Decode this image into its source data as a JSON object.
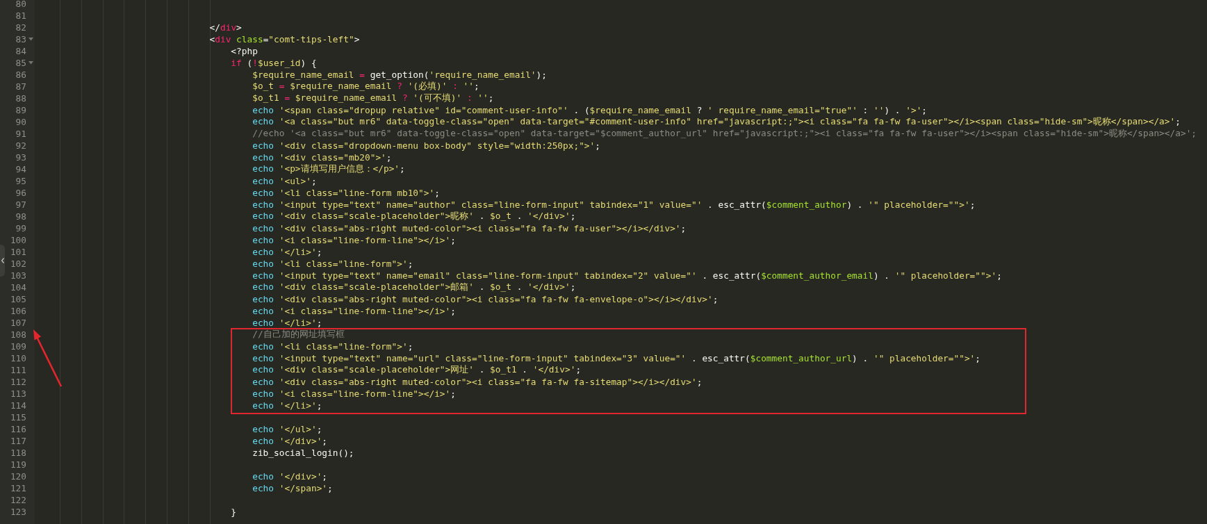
{
  "lines": [
    {
      "number": "80",
      "fold": false,
      "boxed": false
    },
    {
      "number": "81",
      "fold": false,
      "boxed": false
    },
    {
      "number": "82",
      "fold": false,
      "boxed": false,
      "tokens": [
        {
          "kind": "plain",
          "text": "\t\t\t\t\t\t\t\t</"
        },
        {
          "kind": "tag",
          "text": "div"
        },
        {
          "kind": "plain",
          "text": ">"
        }
      ]
    },
    {
      "number": "83",
      "fold": true,
      "boxed": false,
      "tokens": [
        {
          "kind": "plain",
          "text": "\t\t\t\t\t\t\t\t<"
        },
        {
          "kind": "tag",
          "text": "div"
        },
        {
          "kind": "attr",
          "text": " class"
        },
        {
          "kind": "plain",
          "text": "="
        },
        {
          "kind": "str",
          "text": "\"comt-tips-left\""
        },
        {
          "kind": "plain",
          "text": ">"
        }
      ]
    },
    {
      "number": "84",
      "fold": false,
      "boxed": false,
      "tokens": [
        {
          "kind": "plain",
          "text": "\t\t\t\t\t\t\t\t\t<?php"
        }
      ]
    },
    {
      "number": "85",
      "fold": true,
      "boxed": false,
      "tokens": [
        {
          "kind": "kw",
          "text": "\t\t\t\t\t\t\t\t\tif"
        },
        {
          "kind": "plain",
          "text": " ("
        },
        {
          "kind": "op",
          "text": "!"
        },
        {
          "kind": "var",
          "text": "$user_id"
        },
        {
          "kind": "plain",
          "text": ") {"
        }
      ]
    },
    {
      "number": "86",
      "fold": false,
      "boxed": false,
      "tokens": [
        {
          "kind": "var",
          "text": "\t\t\t\t\t\t\t\t\t\t$require_name_email"
        },
        {
          "kind": "op",
          "text": " = "
        },
        {
          "kind": "plain",
          "text": "get_option("
        },
        {
          "kind": "str",
          "text": "'require_name_email'"
        },
        {
          "kind": "plain",
          "text": ");"
        }
      ]
    },
    {
      "number": "87",
      "fold": false,
      "boxed": false,
      "tokens": [
        {
          "kind": "var",
          "text": "\t\t\t\t\t\t\t\t\t\t$o_t"
        },
        {
          "kind": "op",
          "text": " = "
        },
        {
          "kind": "var",
          "text": "$require_name_email"
        },
        {
          "kind": "op",
          "text": " ? "
        },
        {
          "kind": "str",
          "text": "'(必填)'"
        },
        {
          "kind": "op",
          "text": " : "
        },
        {
          "kind": "str",
          "text": "''"
        },
        {
          "kind": "plain",
          "text": ";"
        }
      ]
    },
    {
      "number": "88",
      "fold": false,
      "boxed": false,
      "tokens": [
        {
          "kind": "var",
          "text": "\t\t\t\t\t\t\t\t\t\t$o_t1"
        },
        {
          "kind": "op",
          "text": " = "
        },
        {
          "kind": "var",
          "text": "$require_name_email"
        },
        {
          "kind": "op",
          "text": " ? "
        },
        {
          "kind": "str",
          "text": "'(可不填)'"
        },
        {
          "kind": "op",
          "text": " : "
        },
        {
          "kind": "str",
          "text": "''"
        },
        {
          "kind": "plain",
          "text": ";"
        }
      ]
    },
    {
      "number": "89",
      "fold": false,
      "boxed": false,
      "tokens": [
        {
          "kind": "echo",
          "text": "\t\t\t\t\t\t\t\t\t\techo"
        },
        {
          "kind": "str",
          "text": " '<span class=\"dropup relative\" id=\"comment-user-info\"'"
        },
        {
          "kind": "plain",
          "text": " . ("
        },
        {
          "kind": "var",
          "text": "$require_name_email"
        },
        {
          "kind": "plain",
          "text": " ? "
        },
        {
          "kind": "str",
          "text": "' require_name_email=\"true\"'"
        },
        {
          "kind": "plain",
          "text": " : "
        },
        {
          "kind": "str",
          "text": "''"
        },
        {
          "kind": "plain",
          "text": ") . "
        },
        {
          "kind": "str",
          "text": "'>'"
        },
        {
          "kind": "plain",
          "text": ";"
        }
      ]
    },
    {
      "number": "90",
      "fold": false,
      "boxed": false,
      "tokens": [
        {
          "kind": "echo",
          "text": "\t\t\t\t\t\t\t\t\t\techo"
        },
        {
          "kind": "str",
          "text": " '<a class=\"but mr6\" data-toggle-class=\"open\" data-target=\"#comment-user-info\" href=\"javascript:;\"><i class=\"fa fa-fw fa-user\"></i><span class=\"hide-sm\">昵称</span></a>'"
        },
        {
          "kind": "plain",
          "text": ";"
        }
      ]
    },
    {
      "number": "91",
      "fold": false,
      "boxed": false,
      "tokens": [
        {
          "kind": "comment",
          "text": "\t\t\t\t\t\t\t\t\t\t//echo '<a class=\"but mr6\" data-toggle-class=\"open\" data-target=\"$comment_author_url\" href=\"javascript:;\"><i class=\"fa fa-fw fa-user\"></i><span class=\"hide-sm\">昵称</span></a>';"
        }
      ]
    },
    {
      "number": "92",
      "fold": false,
      "boxed": false,
      "tokens": [
        {
          "kind": "echo",
          "text": "\t\t\t\t\t\t\t\t\t\techo"
        },
        {
          "kind": "str",
          "text": " '<div class=\"dropdown-menu box-body\" style=\"width:250px;\">'"
        },
        {
          "kind": "plain",
          "text": ";"
        }
      ]
    },
    {
      "number": "93",
      "fold": false,
      "boxed": false,
      "tokens": [
        {
          "kind": "echo",
          "text": "\t\t\t\t\t\t\t\t\t\techo"
        },
        {
          "kind": "str",
          "text": " '<div class=\"mb20\">'"
        },
        {
          "kind": "plain",
          "text": ";"
        }
      ]
    },
    {
      "number": "94",
      "fold": false,
      "boxed": false,
      "tokens": [
        {
          "kind": "echo",
          "text": "\t\t\t\t\t\t\t\t\t\techo"
        },
        {
          "kind": "str",
          "text": " '<p>请填写用户信息：</p>'"
        },
        {
          "kind": "plain",
          "text": ";"
        }
      ]
    },
    {
      "number": "95",
      "fold": false,
      "boxed": false,
      "tokens": [
        {
          "kind": "echo",
          "text": "\t\t\t\t\t\t\t\t\t\techo"
        },
        {
          "kind": "str",
          "text": " '<ul>'"
        },
        {
          "kind": "plain",
          "text": ";"
        }
      ]
    },
    {
      "number": "96",
      "fold": false,
      "boxed": false,
      "tokens": [
        {
          "kind": "echo",
          "text": "\t\t\t\t\t\t\t\t\t\techo"
        },
        {
          "kind": "str",
          "text": " '<li class=\"line-form mb10\">'"
        },
        {
          "kind": "plain",
          "text": ";"
        }
      ]
    },
    {
      "number": "97",
      "fold": false,
      "boxed": false,
      "tokens": [
        {
          "kind": "echo",
          "text": "\t\t\t\t\t\t\t\t\t\techo"
        },
        {
          "kind": "str",
          "text": " '<input type=\"text\" name=\"author\" class=\"line-form-input\" tabindex=\"1\" value=\"'"
        },
        {
          "kind": "plain",
          "text": " . esc_attr("
        },
        {
          "kind": "arg",
          "text": "$comment_author"
        },
        {
          "kind": "plain",
          "text": ") . "
        },
        {
          "kind": "str",
          "text": "'\" placeholder=\"\">'"
        },
        {
          "kind": "plain",
          "text": ";"
        }
      ]
    },
    {
      "number": "98",
      "fold": false,
      "boxed": false,
      "tokens": [
        {
          "kind": "echo",
          "text": "\t\t\t\t\t\t\t\t\t\techo"
        },
        {
          "kind": "str",
          "text": " '<div class=\"scale-placeholder\">昵称'"
        },
        {
          "kind": "plain",
          "text": " . "
        },
        {
          "kind": "var",
          "text": "$o_t"
        },
        {
          "kind": "plain",
          "text": " . "
        },
        {
          "kind": "str",
          "text": "'</div>'"
        },
        {
          "kind": "plain",
          "text": ";"
        }
      ]
    },
    {
      "number": "99",
      "fold": false,
      "boxed": false,
      "tokens": [
        {
          "kind": "echo",
          "text": "\t\t\t\t\t\t\t\t\t\techo"
        },
        {
          "kind": "str",
          "text": " '<div class=\"abs-right muted-color\"><i class=\"fa fa-fw fa-user\"></i></div>'"
        },
        {
          "kind": "plain",
          "text": ";"
        }
      ]
    },
    {
      "number": "100",
      "fold": false,
      "boxed": false,
      "tokens": [
        {
          "kind": "echo",
          "text": "\t\t\t\t\t\t\t\t\t\techo"
        },
        {
          "kind": "str",
          "text": " '<i class=\"line-form-line\"></i>'"
        },
        {
          "kind": "plain",
          "text": ";"
        }
      ]
    },
    {
      "number": "101",
      "fold": false,
      "boxed": false,
      "tokens": [
        {
          "kind": "echo",
          "text": "\t\t\t\t\t\t\t\t\t\techo"
        },
        {
          "kind": "str",
          "text": " '</li>'"
        },
        {
          "kind": "plain",
          "text": ";"
        }
      ]
    },
    {
      "number": "102",
      "fold": false,
      "boxed": false,
      "tokens": [
        {
          "kind": "echo",
          "text": "\t\t\t\t\t\t\t\t\t\techo"
        },
        {
          "kind": "str",
          "text": " '<li class=\"line-form\">'"
        },
        {
          "kind": "plain",
          "text": ";"
        }
      ]
    },
    {
      "number": "103",
      "fold": false,
      "boxed": false,
      "tokens": [
        {
          "kind": "echo",
          "text": "\t\t\t\t\t\t\t\t\t\techo"
        },
        {
          "kind": "str",
          "text": " '<input type=\"text\" name=\"email\" class=\"line-form-input\" tabindex=\"2\" value=\"'"
        },
        {
          "kind": "plain",
          "text": " . esc_attr("
        },
        {
          "kind": "arg",
          "text": "$comment_author_email"
        },
        {
          "kind": "plain",
          "text": ") . "
        },
        {
          "kind": "str",
          "text": "'\" placeholder=\"\">'"
        },
        {
          "kind": "plain",
          "text": ";"
        }
      ]
    },
    {
      "number": "104",
      "fold": false,
      "boxed": false,
      "tokens": [
        {
          "kind": "echo",
          "text": "\t\t\t\t\t\t\t\t\t\techo"
        },
        {
          "kind": "str",
          "text": " '<div class=\"scale-placeholder\">邮箱'"
        },
        {
          "kind": "plain",
          "text": " . "
        },
        {
          "kind": "var",
          "text": "$o_t"
        },
        {
          "kind": "plain",
          "text": " . "
        },
        {
          "kind": "str",
          "text": "'</div>'"
        },
        {
          "kind": "plain",
          "text": ";"
        }
      ]
    },
    {
      "number": "105",
      "fold": false,
      "boxed": false,
      "tokens": [
        {
          "kind": "echo",
          "text": "\t\t\t\t\t\t\t\t\t\techo"
        },
        {
          "kind": "str",
          "text": " '<div class=\"abs-right muted-color\"><i class=\"fa fa-fw fa-envelope-o\"></i></div>'"
        },
        {
          "kind": "plain",
          "text": ";"
        }
      ]
    },
    {
      "number": "106",
      "fold": false,
      "boxed": false,
      "tokens": [
        {
          "kind": "echo",
          "text": "\t\t\t\t\t\t\t\t\t\techo"
        },
        {
          "kind": "str",
          "text": " '<i class=\"line-form-line\"></i>'"
        },
        {
          "kind": "plain",
          "text": ";"
        }
      ]
    },
    {
      "number": "107",
      "fold": false,
      "boxed": false,
      "tokens": [
        {
          "kind": "echo",
          "text": "\t\t\t\t\t\t\t\t\t\techo"
        },
        {
          "kind": "str",
          "text": " '</li>'"
        },
        {
          "kind": "plain",
          "text": ";"
        }
      ]
    },
    {
      "number": "108",
      "fold": false,
      "boxed": true,
      "tokens": [
        {
          "kind": "comment",
          "text": "\t\t\t\t\t\t\t\t\t\t//自己加的网址填写框"
        }
      ]
    },
    {
      "number": "109",
      "fold": false,
      "boxed": true,
      "tokens": [
        {
          "kind": "echo",
          "text": "\t\t\t\t\t\t\t\t\t\techo"
        },
        {
          "kind": "str",
          "text": " '<li class=\"line-form\">'"
        },
        {
          "kind": "plain",
          "text": ";"
        }
      ]
    },
    {
      "number": "110",
      "fold": false,
      "boxed": true,
      "tokens": [
        {
          "kind": "echo",
          "text": "\t\t\t\t\t\t\t\t\t\techo"
        },
        {
          "kind": "str",
          "text": " '<input type=\"text\" name=\"url\" class=\"line-form-input\" tabindex=\"3\" value=\"'"
        },
        {
          "kind": "plain",
          "text": " . esc_attr("
        },
        {
          "kind": "arg",
          "text": "$comment_author_url"
        },
        {
          "kind": "plain",
          "text": ") . "
        },
        {
          "kind": "str",
          "text": "'\" placeholder=\"\">'"
        },
        {
          "kind": "plain",
          "text": ";"
        }
      ]
    },
    {
      "number": "111",
      "fold": false,
      "boxed": true,
      "tokens": [
        {
          "kind": "echo",
          "text": "\t\t\t\t\t\t\t\t\t\techo"
        },
        {
          "kind": "str",
          "text": " '<div class=\"scale-placeholder\">网址'"
        },
        {
          "kind": "plain",
          "text": " . "
        },
        {
          "kind": "var",
          "text": "$o_t1"
        },
        {
          "kind": "plain",
          "text": " . "
        },
        {
          "kind": "str",
          "text": "'</div>'"
        },
        {
          "kind": "plain",
          "text": ";"
        }
      ]
    },
    {
      "number": "112",
      "fold": false,
      "boxed": true,
      "tokens": [
        {
          "kind": "echo",
          "text": "\t\t\t\t\t\t\t\t\t\techo"
        },
        {
          "kind": "str",
          "text": " '<div class=\"abs-right muted-color\"><i class=\"fa fa-fw fa-sitemap\"></i></div>'"
        },
        {
          "kind": "plain",
          "text": ";"
        }
      ]
    },
    {
      "number": "113",
      "fold": false,
      "boxed": true,
      "tokens": [
        {
          "kind": "echo",
          "text": "\t\t\t\t\t\t\t\t\t\techo"
        },
        {
          "kind": "str",
          "text": " '<i class=\"line-form-line\"></i>'"
        },
        {
          "kind": "plain",
          "text": ";"
        }
      ]
    },
    {
      "number": "114",
      "fold": false,
      "boxed": true,
      "tokens": [
        {
          "kind": "echo",
          "text": "\t\t\t\t\t\t\t\t\t\techo"
        },
        {
          "kind": "str",
          "text": " '</li>'"
        },
        {
          "kind": "plain",
          "text": ";"
        }
      ]
    },
    {
      "number": "115",
      "fold": false,
      "boxed": false
    },
    {
      "number": "116",
      "fold": false,
      "boxed": false,
      "tokens": [
        {
          "kind": "echo",
          "text": "\t\t\t\t\t\t\t\t\t\techo"
        },
        {
          "kind": "str",
          "text": " '</ul>'"
        },
        {
          "kind": "plain",
          "text": ";"
        }
      ]
    },
    {
      "number": "117",
      "fold": false,
      "boxed": false,
      "tokens": [
        {
          "kind": "echo",
          "text": "\t\t\t\t\t\t\t\t\t\techo"
        },
        {
          "kind": "str",
          "text": " '</div>'"
        },
        {
          "kind": "plain",
          "text": ";"
        }
      ]
    },
    {
      "number": "118",
      "fold": false,
      "boxed": false,
      "tokens": [
        {
          "kind": "plain",
          "text": "\t\t\t\t\t\t\t\t\t\tzib_social_login();"
        }
      ]
    },
    {
      "number": "119",
      "fold": false,
      "boxed": false
    },
    {
      "number": "120",
      "fold": false,
      "boxed": false,
      "tokens": [
        {
          "kind": "echo",
          "text": "\t\t\t\t\t\t\t\t\t\techo"
        },
        {
          "kind": "str",
          "text": " '</div>'"
        },
        {
          "kind": "plain",
          "text": ";"
        }
      ]
    },
    {
      "number": "121",
      "fold": false,
      "boxed": false,
      "tokens": [
        {
          "kind": "echo",
          "text": "\t\t\t\t\t\t\t\t\t\techo"
        },
        {
          "kind": "str",
          "text": " '</span>'"
        },
        {
          "kind": "plain",
          "text": ";"
        }
      ]
    },
    {
      "number": "122",
      "fold": false,
      "boxed": false
    },
    {
      "number": "123",
      "fold": false,
      "boxed": false,
      "tokens": [
        {
          "kind": "plain",
          "text": "\t\t\t\t\t\t\t\t\t}"
        }
      ]
    }
  ]
}
